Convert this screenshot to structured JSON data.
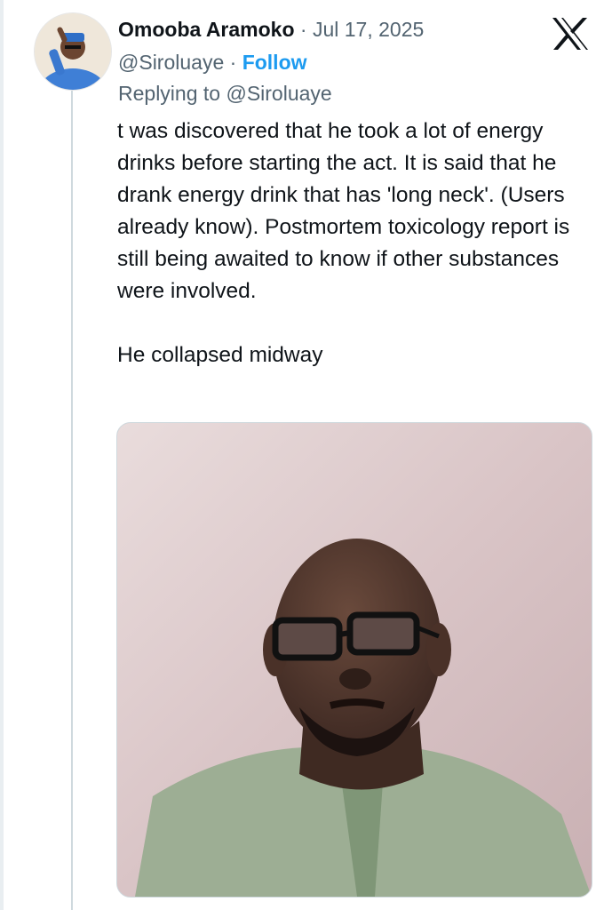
{
  "tweet": {
    "author": {
      "display_name": "Omooba Aramoko",
      "handle": "@Siroluaye",
      "avatar_icon": "profile-photo-avatar"
    },
    "separator": "·",
    "date": "Jul 17, 2025",
    "follow_label": "Follow",
    "replying_prefix": "Replying to",
    "replying_to": "@Siroluaye",
    "paragraphs": [
      "t was discovered that he took a lot of energy drinks before starting the act. It is said that he drank energy drink that has 'long neck'. (Users already know). Postmortem toxicology report is still being awaited to know if other substances were involved.",
      "He collapsed midway"
    ],
    "media": {
      "icon": "photo-of-man-with-glasses",
      "background_color": "#d8c4c6"
    }
  },
  "brand": {
    "logo_icon": "x-logo-icon",
    "accent_color": "#1d9bf0",
    "text_color": "#0f1419",
    "muted_color": "#536471"
  }
}
